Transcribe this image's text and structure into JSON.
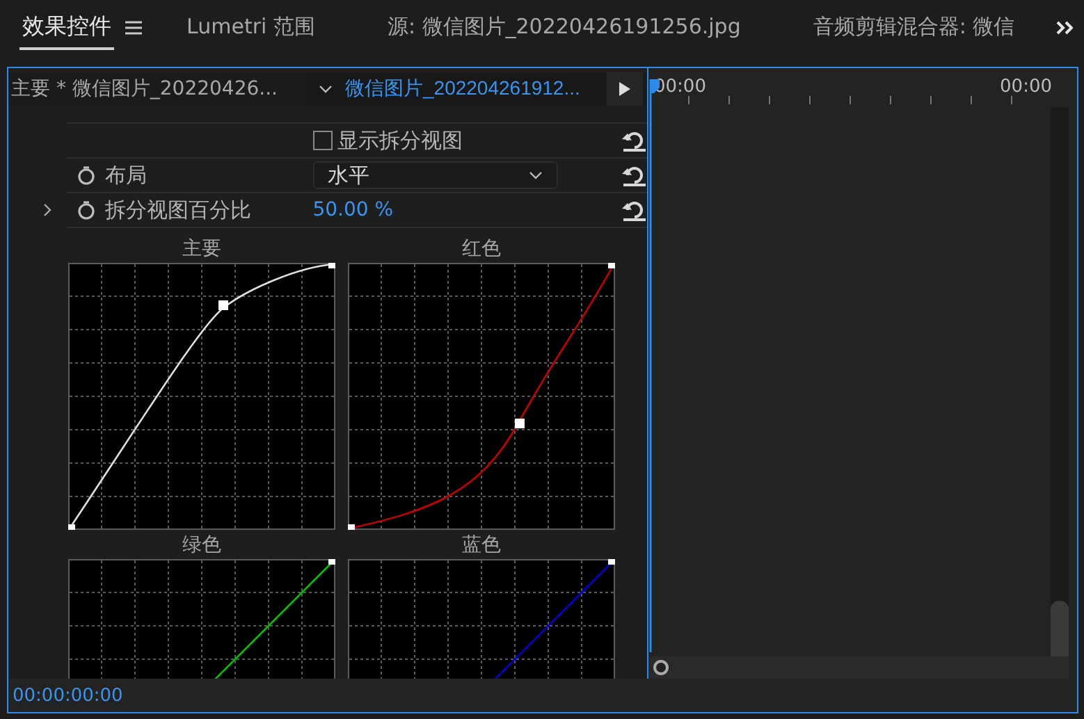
{
  "tabs": [
    {
      "label": "效果控件",
      "selected": true
    },
    {
      "label": "Lumetri 范围",
      "selected": false
    },
    {
      "label": "源: 微信图片_20220426191256.jpg",
      "selected": false
    },
    {
      "label": "音频剪辑混合器: 微信",
      "selected": false
    }
  ],
  "clip_header": {
    "master": "主要 * 微信图片_20220426...",
    "clip": "微信图片_202204261912...",
    "time_start": "00:00",
    "time_end": "00:00"
  },
  "rows": [
    {
      "kind": "checkbox",
      "label": "显示拆分视图",
      "checked": false
    },
    {
      "kind": "dropdown",
      "label": "布局",
      "value": "水平"
    },
    {
      "kind": "value",
      "label": "拆分视图百分比",
      "value": "50.00 %",
      "expanded": false
    }
  ],
  "curves": [
    {
      "label": "主要",
      "color": "#e0e0e0",
      "kind": "ease-out"
    },
    {
      "label": "红色",
      "color": "#c00000",
      "kind": "ease-in"
    },
    {
      "label": "绿色",
      "color": "#00c000",
      "kind": "linear"
    },
    {
      "label": "蓝色",
      "color": "#0000c0",
      "kind": "linear"
    }
  ],
  "footer": {
    "timecode": "00:00:00:00"
  }
}
